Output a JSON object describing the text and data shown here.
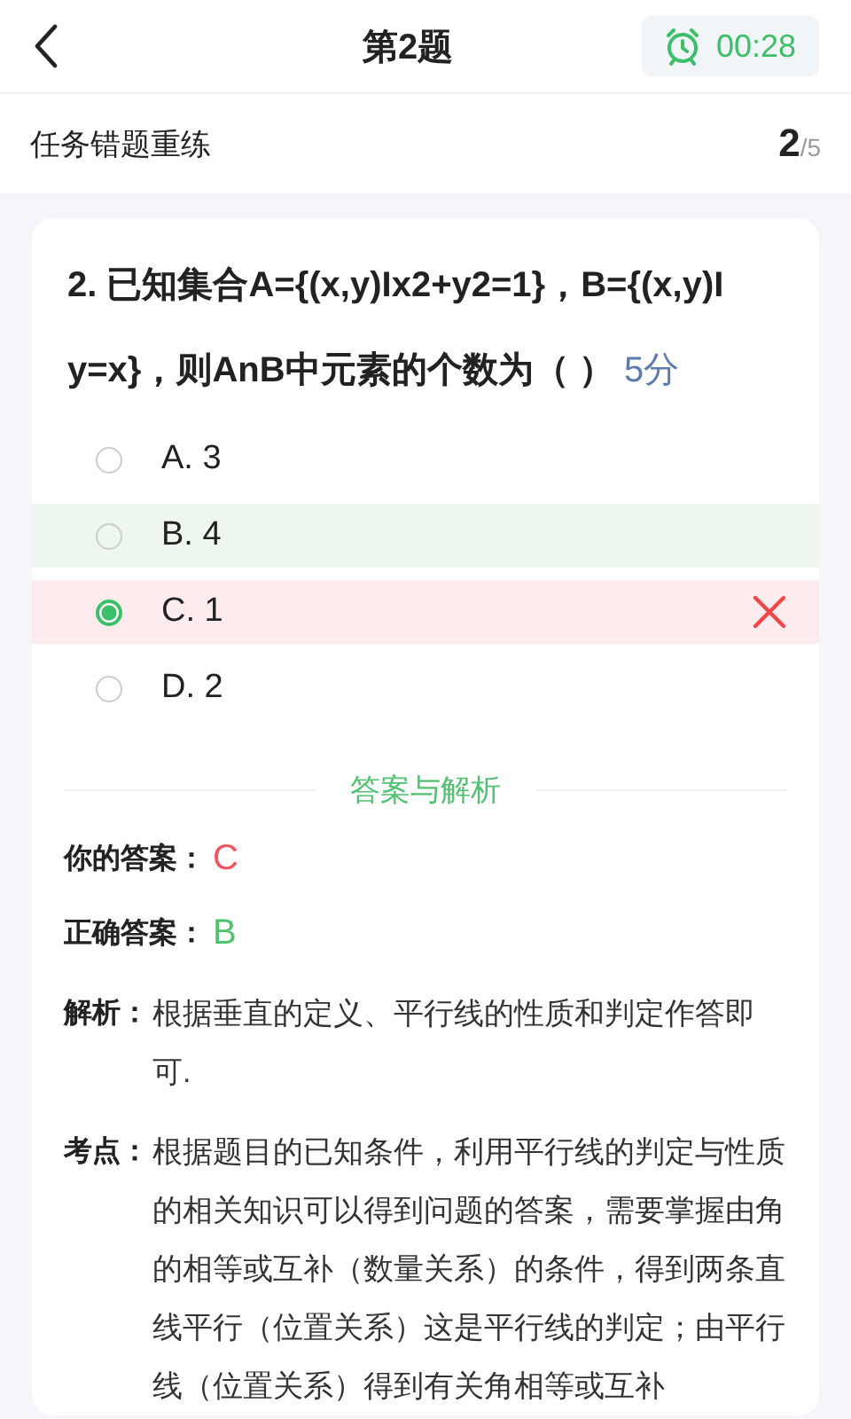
{
  "header": {
    "title": "第2题",
    "timer": "00:28"
  },
  "task": {
    "title": "任务错题重练",
    "current": "2",
    "total": "/5"
  },
  "question": {
    "text": "2. 已知集合A={(x,y)Ix2+y2=1}，B={(x,y)I y=x}，则AnB中元素的个数为（  ）",
    "score": "5分"
  },
  "options": [
    {
      "label": "A. 3",
      "selected": false,
      "correct": false,
      "wrong": false
    },
    {
      "label": "B. 4",
      "selected": false,
      "correct": true,
      "wrong": false
    },
    {
      "label": "C. 1",
      "selected": true,
      "correct": false,
      "wrong": true
    },
    {
      "label": "D. 2",
      "selected": false,
      "correct": false,
      "wrong": false
    }
  ],
  "analysis": {
    "heading": "答案与解析",
    "your_answer": {
      "label": "你的答案：",
      "value": "C",
      "correct": false
    },
    "correct_answer": {
      "label": "正确答案：",
      "value": "B",
      "correct": true
    },
    "items": [
      {
        "label": "解析：",
        "text": "根据垂直的定义、平行线的性质和判定作答即可."
      },
      {
        "label": "考点：",
        "text": "根据题目的已知条件，利用平行线的判定与性质的相关知识可以得到问题的答案，需要掌握由角的相等或互补（数量关系）的条件，得到两条直线平行（位置关系）这是平行线的判定；由平行线（位置关系）得到有关角相等或互补"
      }
    ]
  }
}
